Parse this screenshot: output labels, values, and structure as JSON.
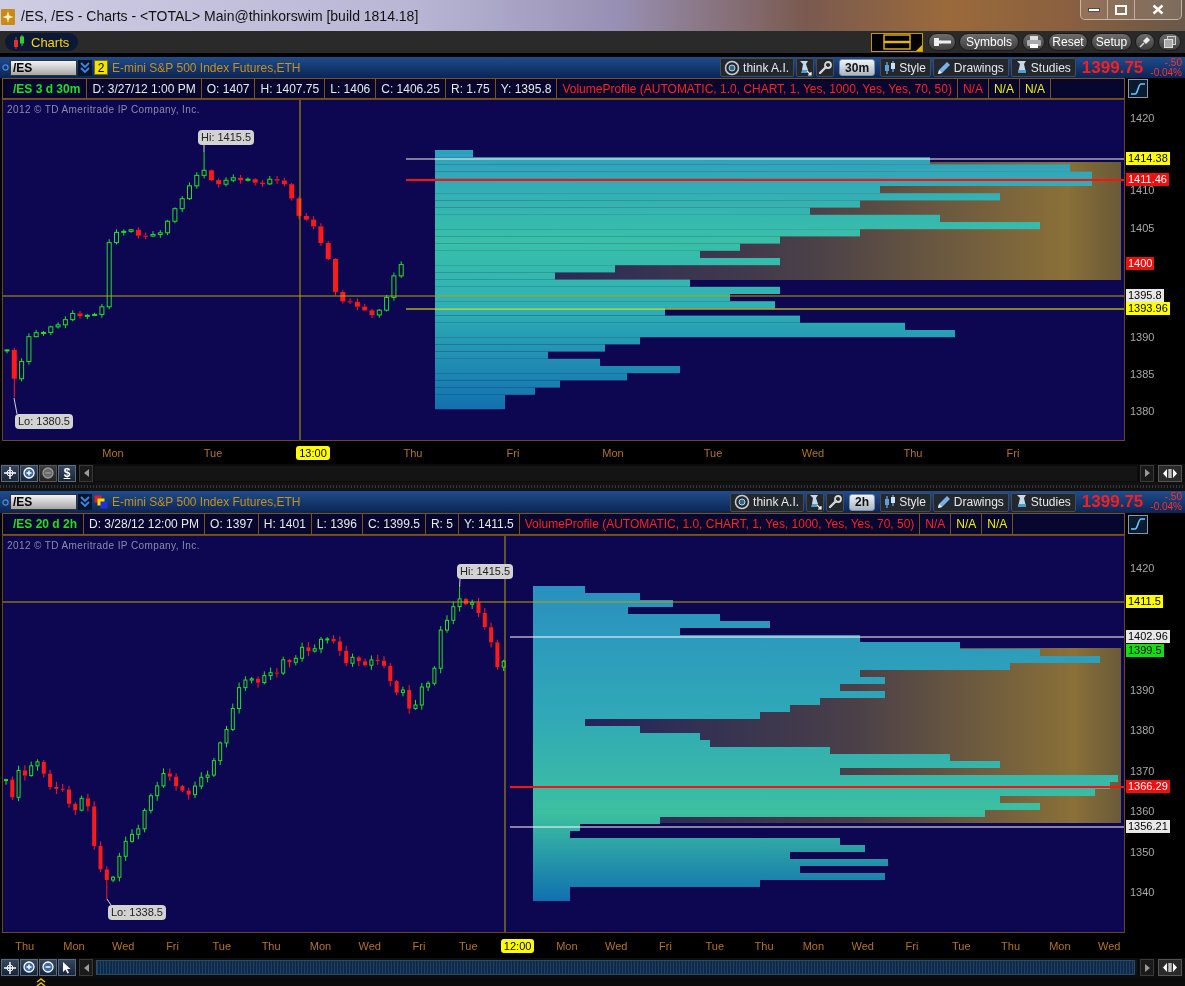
{
  "window": {
    "title": "/ES, /ES - Charts - <TOTAL> Main@thinkorswim [build 1814.18]"
  },
  "app_toolbar": {
    "tab": {
      "label": "Charts",
      "selected": true
    },
    "buttons": [
      "Symbols",
      "Reset",
      "Setup"
    ]
  },
  "charts": [
    {
      "symbol": "/ES",
      "link_badge": "2",
      "description": "E-mini S&P 500 Index Futures,ETH",
      "tools": {
        "ai": "think A.I.",
        "timeframe": "30m",
        "style": "Style",
        "drawings": "Drawings",
        "studies": "Studies"
      },
      "last_price": "1399.75",
      "change": "-.50",
      "change_percent": "-0.04%",
      "info": [
        {
          "text": "/ES 3 d 30m",
          "color": "#22dd22"
        },
        {
          "text": "D: 3/27/12 1:00 PM",
          "color": "#e8e8e8"
        },
        {
          "text": "O: 1407",
          "color": "#e8e8e8"
        },
        {
          "text": "H: 1407.75",
          "color": "#e8e8e8"
        },
        {
          "text": "L: 1406",
          "color": "#e8e8e8"
        },
        {
          "text": "C: 1406.25",
          "color": "#e8e8e8"
        },
        {
          "text": "R: 1.75",
          "color": "#e8e8e8"
        },
        {
          "text": "Y: 1395.8",
          "color": "#e8e8e8"
        },
        {
          "text": "VolumeProfile (AUTOMATIC, 1.0, CHART, 1, Yes, 1000, Yes, Yes, 70, 50)",
          "color": "#ff2020"
        },
        {
          "text": "N/A",
          "color": "#ff2020"
        },
        {
          "text": "N/A",
          "color": "#f0f000"
        },
        {
          "text": "N/A",
          "color": "#f0f000"
        }
      ],
      "copyright": "2012 © TD Ameritrade IP Company, Inc.",
      "high_label": "Hi: 1415.5",
      "low_label": "Lo: 1380.5",
      "price_ticks": [
        "1420",
        "1410",
        "1405",
        "1390",
        "1385",
        "1380"
      ],
      "price_markers": [
        {
          "label": "1414.38",
          "color": "#ffff00"
        },
        {
          "label": "1411.46",
          "color": "#ee1010"
        },
        {
          "label": "1400",
          "color": "#ee1010"
        },
        {
          "label": "1395.8",
          "color": "#e8e8e8"
        },
        {
          "label": "1393.96",
          "color": "#ffff00"
        }
      ],
      "time_labels": [
        {
          "text": "Mon",
          "kind": "day"
        },
        {
          "text": "Tue",
          "kind": "day"
        },
        {
          "text": "13:00",
          "kind": "cursor"
        },
        {
          "text": "Thu",
          "kind": "day"
        },
        {
          "text": "Fri",
          "kind": "day"
        },
        {
          "text": "Mon",
          "kind": "day"
        },
        {
          "text": "Tue",
          "kind": "day"
        },
        {
          "text": "Wed",
          "kind": "day"
        },
        {
          "text": "Thu",
          "kind": "day"
        },
        {
          "text": "Fri",
          "kind": "day"
        }
      ],
      "scroll_button": "$",
      "zoom_out_disabled": true,
      "scrollbar_visible": false
    },
    {
      "symbol": "/ES",
      "description": "E-mini S&P 500 Index Futures,ETH",
      "tools": {
        "ai": "think A.I.",
        "timeframe": "2h",
        "style": "Style",
        "drawings": "Drawings",
        "studies": "Studies"
      },
      "last_price": "1399.75",
      "change": "-.50",
      "change_percent": "-0.04%",
      "info": [
        {
          "text": "/ES 20 d 2h",
          "color": "#22dd22"
        },
        {
          "text": "D: 3/28/12 12:00 PM",
          "color": "#e8e8e8"
        },
        {
          "text": "O: 1397",
          "color": "#e8e8e8"
        },
        {
          "text": "H: 1401",
          "color": "#e8e8e8"
        },
        {
          "text": "L: 1396",
          "color": "#e8e8e8"
        },
        {
          "text": "C: 1399.5",
          "color": "#e8e8e8"
        },
        {
          "text": "R: 5",
          "color": "#e8e8e8"
        },
        {
          "text": "Y: 1411.5",
          "color": "#e8e8e8"
        },
        {
          "text": "VolumeProfile (AUTOMATIC, 1.0, CHART, 1, Yes, 1000, Yes, Yes, 70, 50)",
          "color": "#ff2020"
        },
        {
          "text": "N/A",
          "color": "#ff2020"
        },
        {
          "text": "N/A",
          "color": "#f0f000"
        },
        {
          "text": "N/A",
          "color": "#f0f000"
        }
      ],
      "copyright": "2012 © TD Ameritrade IP Company, Inc.",
      "high_label": "Hi: 1415.5",
      "low_label": "Lo: 1338.5",
      "price_ticks": [
        "1420",
        "1390",
        "1380",
        "1370",
        "1360",
        "1350",
        "1340"
      ],
      "price_markers": [
        {
          "label": "1411.5",
          "color": "#ffff00"
        },
        {
          "label": "1402.96",
          "color": "#e8e8e8"
        },
        {
          "label": "1399.5",
          "color": "#10e010"
        },
        {
          "label": "1366.29",
          "color": "#ee1010"
        },
        {
          "label": "1356.21",
          "color": "#e8e8e8"
        }
      ],
      "time_labels": [
        {
          "text": "Thu",
          "kind": "day"
        },
        {
          "text": "Mon",
          "kind": "day"
        },
        {
          "text": "Wed",
          "kind": "day"
        },
        {
          "text": "Fri",
          "kind": "day"
        },
        {
          "text": "Tue",
          "kind": "day"
        },
        {
          "text": "Thu",
          "kind": "day"
        },
        {
          "text": "Mon",
          "kind": "day"
        },
        {
          "text": "Wed",
          "kind": "day"
        },
        {
          "text": "Fri",
          "kind": "day"
        },
        {
          "text": "Tue",
          "kind": "day"
        },
        {
          "text": "12:00",
          "kind": "cursor"
        },
        {
          "text": "Mon",
          "kind": "day"
        },
        {
          "text": "Wed",
          "kind": "day"
        },
        {
          "text": "Fri",
          "kind": "day"
        },
        {
          "text": "Tue",
          "kind": "day"
        },
        {
          "text": "Thu",
          "kind": "day"
        },
        {
          "text": "Mon",
          "kind": "day"
        },
        {
          "text": "Wed",
          "kind": "day"
        },
        {
          "text": "Fri",
          "kind": "day"
        },
        {
          "text": "Tue",
          "kind": "day"
        },
        {
          "text": "Thu",
          "kind": "day"
        },
        {
          "text": "Mon",
          "kind": "day"
        },
        {
          "text": "Wed",
          "kind": "day"
        }
      ],
      "zoom_out_disabled": false,
      "scrollbar_visible": true
    }
  ]
}
